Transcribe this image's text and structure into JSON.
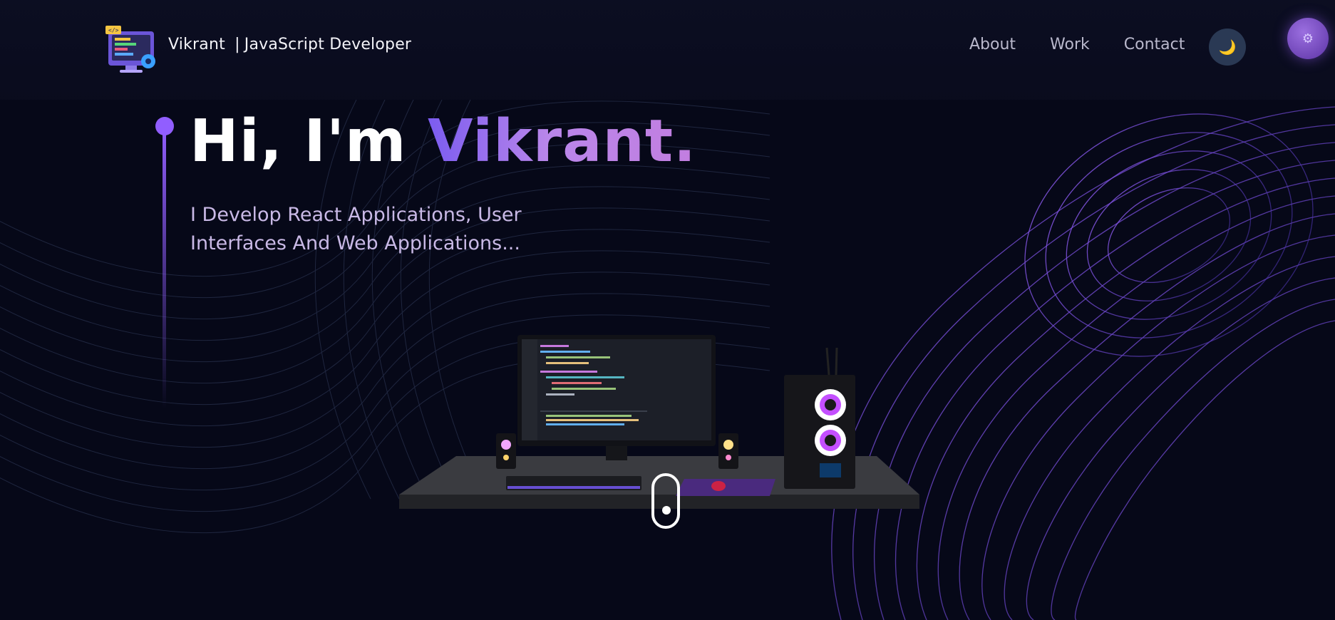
{
  "header": {
    "brand_name": "Vikrant",
    "brand_separator": "|",
    "brand_role": "JavaScript Developer",
    "logo_icon": "developer-monitor-icon",
    "nav_links": [
      {
        "label": "About"
      },
      {
        "label": "Work"
      },
      {
        "label": "Contact"
      }
    ],
    "theme_toggle_icon": "moon-icon",
    "theme_toggle_glyph": "🌙",
    "settings_icon": "gear-icon",
    "settings_glyph": "⚙"
  },
  "hero": {
    "greeting": "Hi, I'm ",
    "name": "Vikrant.",
    "subtitle_line1": "I Develop React Applications, User",
    "subtitle_line2": "Interfaces And Web Applications..."
  },
  "scene": {
    "description_icon": "desk-setup-illustration"
  },
  "colors": {
    "background": "#060818",
    "accent": "#915eff",
    "nav_text": "#b9b8cc",
    "subtitle": "#c9b9e6",
    "toggle_bg": "#2a3954"
  }
}
